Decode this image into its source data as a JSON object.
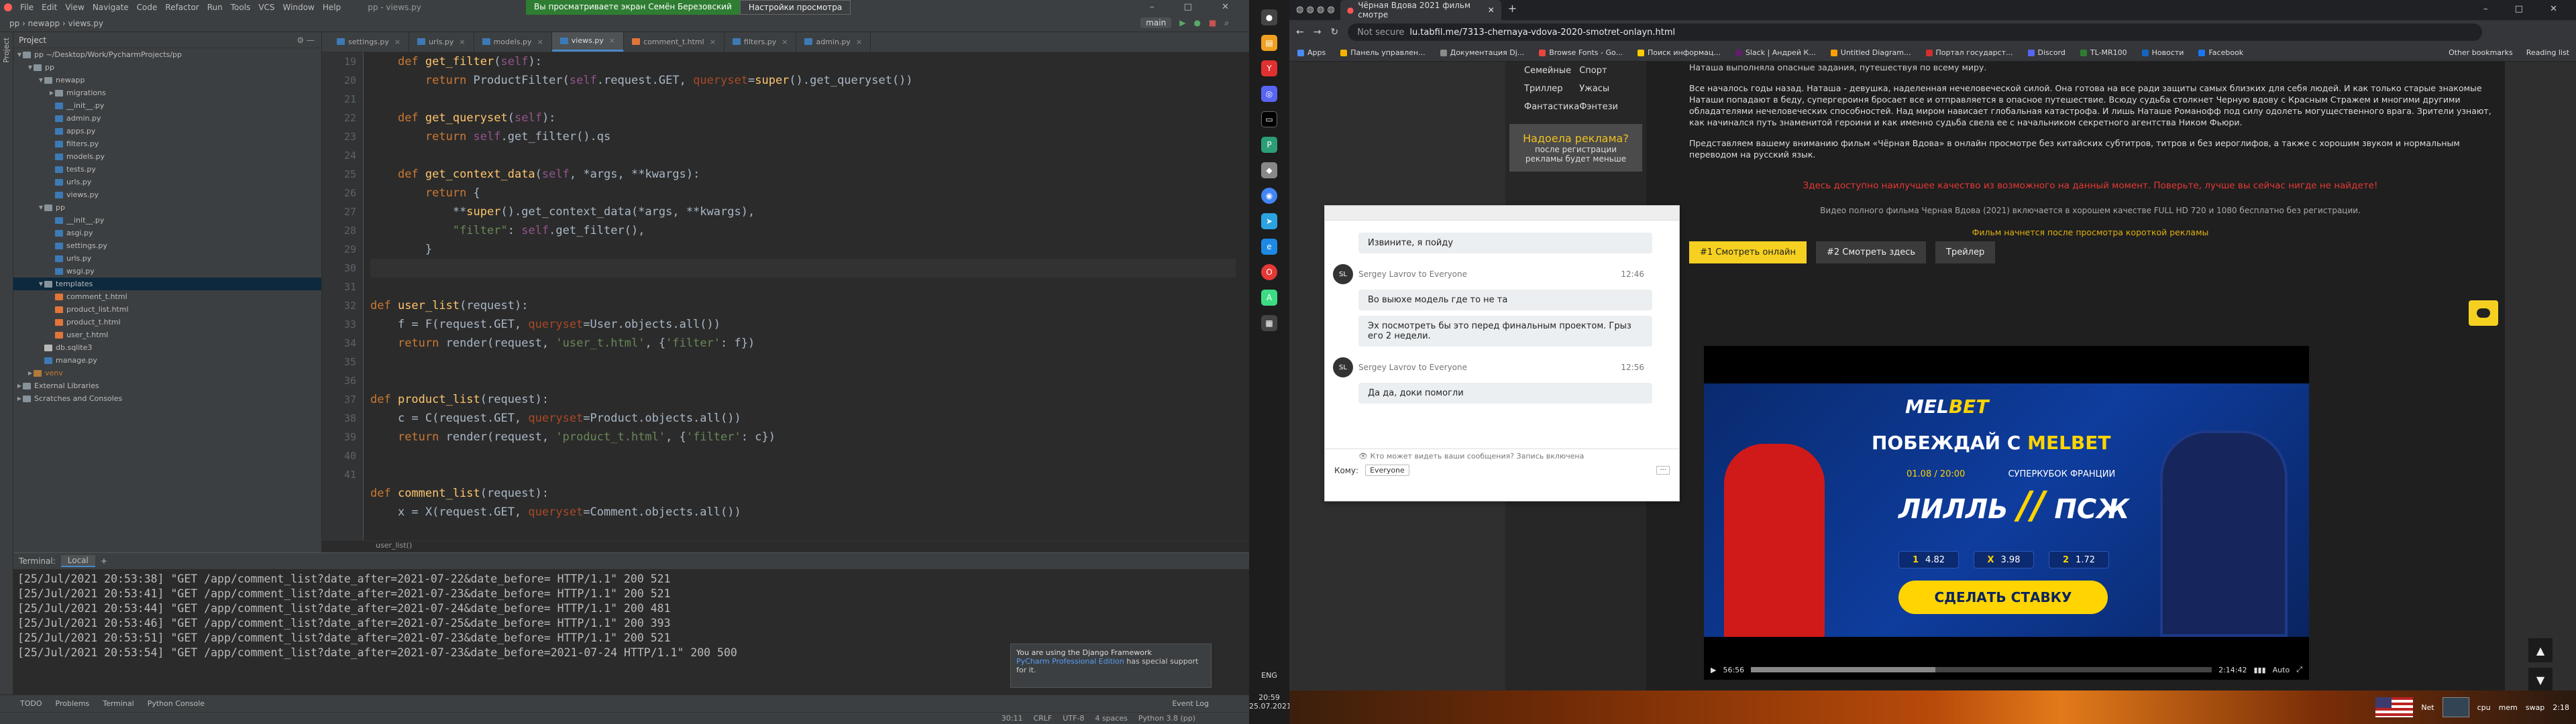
{
  "ide": {
    "menu": [
      "File",
      "Edit",
      "View",
      "Navigate",
      "Code",
      "Refactor",
      "Run",
      "Tools",
      "VCS",
      "Window",
      "Help"
    ],
    "share_banner": "Вы просматриваете экран Семён Березовский",
    "share_settings": "Настройки просмотра",
    "breadcrumb": [
      "pp",
      "newapp",
      "views.py"
    ],
    "run_config": "main",
    "window_title": "pp - views.py",
    "project_title": "Project",
    "project_root": "pp ~/Desktop/Work/PycharmProjects/pp",
    "tree": [
      {
        "indent": 1,
        "type": "fold",
        "label": "pp",
        "open": true
      },
      {
        "indent": 2,
        "type": "fold",
        "label": "newapp",
        "open": true
      },
      {
        "indent": 3,
        "type": "fold",
        "label": "migrations",
        "open": false
      },
      {
        "indent": 3,
        "type": "py",
        "label": "__init__.py"
      },
      {
        "indent": 3,
        "type": "py",
        "label": "admin.py"
      },
      {
        "indent": 3,
        "type": "py",
        "label": "apps.py"
      },
      {
        "indent": 3,
        "type": "py",
        "label": "filters.py"
      },
      {
        "indent": 3,
        "type": "py",
        "label": "models.py"
      },
      {
        "indent": 3,
        "type": "py",
        "label": "tests.py"
      },
      {
        "indent": 3,
        "type": "py",
        "label": "urls.py"
      },
      {
        "indent": 3,
        "type": "py",
        "label": "views.py"
      },
      {
        "indent": 2,
        "type": "fold",
        "label": "pp",
        "open": true
      },
      {
        "indent": 3,
        "type": "py",
        "label": "__init__.py"
      },
      {
        "indent": 3,
        "type": "py",
        "label": "asgi.py"
      },
      {
        "indent": 3,
        "type": "py",
        "label": "settings.py"
      },
      {
        "indent": 3,
        "type": "py",
        "label": "urls.py"
      },
      {
        "indent": 3,
        "type": "py",
        "label": "wsgi.py"
      },
      {
        "indent": 2,
        "type": "fold",
        "label": "templates",
        "open": true,
        "selected": true
      },
      {
        "indent": 3,
        "type": "html",
        "label": "comment_t.html"
      },
      {
        "indent": 3,
        "type": "html",
        "label": "product_list.html"
      },
      {
        "indent": 3,
        "type": "html",
        "label": "product_t.html"
      },
      {
        "indent": 3,
        "type": "html",
        "label": "user_t.html"
      },
      {
        "indent": 2,
        "type": "db",
        "label": "db.sqlite3"
      },
      {
        "indent": 2,
        "type": "py",
        "label": "manage.py"
      },
      {
        "indent": 1,
        "type": "fold",
        "label": "venv",
        "open": false,
        "excluded": true
      },
      {
        "indent": 0,
        "type": "fold",
        "label": "External Libraries",
        "open": false
      },
      {
        "indent": 0,
        "type": "fold",
        "label": "Scratches and Consoles",
        "open": false
      }
    ],
    "tabs": [
      "settings.py",
      "urls.py",
      "models.py",
      "views.py",
      "comment_t.html",
      "filters.py",
      "admin.py"
    ],
    "active_tab": "views.py",
    "line_numbers": [
      "19",
      "20",
      "21",
      "22",
      "23",
      "24",
      "25",
      "26",
      "27",
      "28",
      "29",
      "30",
      "31",
      "32",
      "33",
      "34",
      "35",
      "36",
      "37",
      "38",
      "39",
      "40",
      "41"
    ],
    "highlight_line": 30,
    "code": [
      [
        [
          "    ",
          ""
        ],
        [
          "def ",
          "kw"
        ],
        [
          "get_filter",
          "fn"
        ],
        [
          "(",
          ""
        ],
        [
          "self",
          "sf"
        ],
        [
          "):",
          ""
        ]
      ],
      [
        [
          "        ",
          ""
        ],
        [
          "return ",
          "kw"
        ],
        [
          "ProductFilter(",
          ""
        ],
        [
          "self",
          "sf"
        ],
        [
          ".request.GET, ",
          ""
        ],
        [
          "queryset",
          "prm"
        ],
        [
          "=",
          ""
        ],
        [
          "super",
          "fn"
        ],
        [
          "().get_queryset())",
          ""
        ]
      ],
      [
        [
          "",
          ""
        ]
      ],
      [
        [
          "    ",
          ""
        ],
        [
          "def ",
          "kw"
        ],
        [
          "get_queryset",
          "fn"
        ],
        [
          "(",
          ""
        ],
        [
          "self",
          "sf"
        ],
        [
          "):",
          ""
        ]
      ],
      [
        [
          "        ",
          ""
        ],
        [
          "return ",
          "kw"
        ],
        [
          "self",
          "sf"
        ],
        [
          ".get_filter().qs",
          ""
        ]
      ],
      [
        [
          "",
          ""
        ]
      ],
      [
        [
          "    ",
          ""
        ],
        [
          "def ",
          "kw"
        ],
        [
          "get_context_data",
          "fn"
        ],
        [
          "(",
          ""
        ],
        [
          "self",
          "sf"
        ],
        [
          ", *args, **kwargs):",
          ""
        ]
      ],
      [
        [
          "        ",
          ""
        ],
        [
          "return ",
          "kw"
        ],
        [
          "{",
          ""
        ]
      ],
      [
        [
          "            **",
          ""
        ],
        [
          "super",
          "fn"
        ],
        [
          "().get_context_data(*args, **kwargs),",
          ""
        ]
      ],
      [
        [
          "            ",
          ""
        ],
        [
          "\"filter\"",
          "str"
        ],
        [
          ": ",
          ""
        ],
        [
          "self",
          "sf"
        ],
        [
          ".get_filter(),",
          ""
        ]
      ],
      [
        [
          "        }",
          ""
        ]
      ],
      [
        [
          "",
          ""
        ]
      ],
      [
        [
          "",
          ""
        ]
      ],
      [
        [
          "def ",
          "kw"
        ],
        [
          "user_list",
          "fn"
        ],
        [
          "(request):",
          ""
        ]
      ],
      [
        [
          "    f = F(request.GET, ",
          ""
        ],
        [
          "queryset",
          "prm"
        ],
        [
          "=User.objects.all())",
          ""
        ]
      ],
      [
        [
          "    ",
          ""
        ],
        [
          "return ",
          "kw"
        ],
        [
          "render(request, ",
          ""
        ],
        [
          "'user_t.html'",
          "str"
        ],
        [
          ", {",
          ""
        ],
        [
          "'filter'",
          "str"
        ],
        [
          ": f})",
          ""
        ]
      ],
      [
        [
          "",
          ""
        ]
      ],
      [
        [
          "",
          ""
        ]
      ],
      [
        [
          "def ",
          "kw"
        ],
        [
          "product_list",
          "fn"
        ],
        [
          "(request):",
          ""
        ]
      ],
      [
        [
          "    c = C(request.GET, ",
          ""
        ],
        [
          "queryset",
          "prm"
        ],
        [
          "=Product.objects.all())",
          ""
        ]
      ],
      [
        [
          "    ",
          ""
        ],
        [
          "return ",
          "kw"
        ],
        [
          "render(request, ",
          ""
        ],
        [
          "'product_t.html'",
          "str"
        ],
        [
          ", {",
          ""
        ],
        [
          "'filter'",
          "str"
        ],
        [
          ": c})",
          ""
        ]
      ],
      [
        [
          "",
          ""
        ]
      ],
      [
        [
          "",
          ""
        ]
      ],
      [
        [
          "def ",
          "kw"
        ],
        [
          "comment_list",
          "fn"
        ],
        [
          "(request):",
          ""
        ]
      ],
      [
        [
          "    x = X(request.GET, ",
          ""
        ],
        [
          "queryset",
          "prm"
        ],
        [
          "=Comment.objects.all())",
          ""
        ]
      ]
    ],
    "editor_footer": "user_list()",
    "terminal_title": "Terminal:",
    "terminal_tab": "Local",
    "terminal_lines": [
      "[25/Jul/2021 20:53:38] \"GET /app/comment_list?date_after=2021-07-22&date_before= HTTP/1.1\" 200 521",
      "[25/Jul/2021 20:53:41] \"GET /app/comment_list?date_after=2021-07-23&date_before= HTTP/1.1\" 200 521",
      "[25/Jul/2021 20:53:44] \"GET /app/comment_list?date_after=2021-07-24&date_before= HTTP/1.1\" 200 481",
      "[25/Jul/2021 20:53:46] \"GET /app/comment_list?date_after=2021-07-25&date_before= HTTP/1.1\" 200 393",
      "[25/Jul/2021 20:53:51] \"GET /app/comment_list?date_after=2021-07-23&date_before= HTTP/1.1\" 200 521",
      "[25/Jul/2021 20:53:54] \"GET /app/comment_list?date_after=2021-07-23&date_before=2021-07-24 HTTP/1.1\" 200 500"
    ],
    "notice_title": "You are using the Django Framework",
    "notice_link": "PyCharm Professional Edition",
    "notice_text": "has special support for it.",
    "bottom_tools": [
      "TODO",
      "Problems",
      "Terminal",
      "Python Console"
    ],
    "event_log": "Event Log",
    "status": [
      "30:11",
      "CRLF",
      "UTF-8",
      "4 spaces",
      "Python 3.8 (pp)"
    ]
  },
  "taskbar": {
    "lang": "ENG",
    "time": "20:59",
    "date": "25.07.2021"
  },
  "browser": {
    "tab_title": "Чёрная Вдова 2021 фильм смотре",
    "url_prefix": "Not secure",
    "url": "lu.tabfil.me/7313-chernaya-vdova-2020-smotret-onlayn.html",
    "bookmarks": [
      "Apps",
      "Панель управлен...",
      "Документация Dj...",
      "Browse Fonts - Go...",
      "Поиск информац...",
      "Slack | Андрей К...",
      "Untitled Diagram...",
      "Портал государст...",
      "Discord",
      "TL-MR100",
      "Новости",
      "Facebook"
    ],
    "bookmarks_right": [
      "Other bookmarks",
      "Reading list"
    ],
    "genres": [
      "Семейные",
      "Спорт",
      "Триллер",
      "Ужасы",
      "Фантастика",
      "Фэнтези"
    ],
    "ad_title": "Надоела реклама?",
    "ad_sub": "после регистрации рекламы будет меньше",
    "para0": "Наташа выполняла опасные задания, путешествуя по всему миру.",
    "para1": "Все началось годы назад. Наташа - девушка, наделенная нечеловеческой силой. Она готова на все ради защиты самых близких для себя людей. И как только старые знакомые Наташи попадают в беду, супергероиня бросает все и отправляется в опасное путешествие. Всюду судьба столкнет Черную вдову с Красным Стражем и многими другими обладателями нечеловеческих способностей. Над миром нависает глобальная катастрофа. И лишь Наташе Романофф под силу одолеть могущественного врага. Зрители узнают, как начинался путь знаменитой героини и как именно судьба свела ее с начальником секретного агентства Ником Фьюри.",
    "para2": "Представляем вашему вниманию фильм «Чёрная Вдова» в онлайн просмотре без китайских субтитров, титров и без иероглифов, а также с хорошим звуком и нормальным переводом на русский язык.",
    "red_notice": "Здесь доступно наилучшее качество из возможного на данный момент. Поверьте, лучше вы сейчас нигде не найдете!",
    "grey_notice": "Видео полного фильма Черная Вдова (2021) включается в хорошем качестве FULL HD 720 и 1080 бесплатно без регистрации.",
    "yellow_notice": "Фильм начнется после просмотра короткой рекламы",
    "watch_btn1": "#1 Смотреть онлайн",
    "watch_btn2": "#2 Смотреть здесь",
    "trailer_btn": "Трейлер",
    "ad": {
      "logo_a": "MEL",
      "logo_b": "BET",
      "headline_a": "ПОБЕЖДАЙ С ",
      "headline_b": "MELBET",
      "date": "01.08 / 20:00",
      "tag": "СУПЕРКУБОК ФРАНЦИИ",
      "team1": "ЛИЛЛЬ",
      "team2": "ПСЖ",
      "odds": [
        [
          "1",
          "4.82"
        ],
        [
          "X",
          "3.98"
        ],
        [
          "2",
          "1.72"
        ]
      ],
      "cta": "СДЕЛАТЬ СТАВКУ"
    },
    "player_time": "56:56",
    "player_duration": "2:14:42",
    "player_progress": 0.4,
    "player_quality": "Auto",
    "scroll_up": "▲",
    "scroll_down": "▼"
  },
  "chat": {
    "messages": [
      {
        "type": "bubble",
        "text": "Извините, я пойду"
      },
      {
        "type": "sender",
        "avatar": "SL",
        "name": "Sergey Lavrov to Everyone",
        "time": "12:46"
      },
      {
        "type": "bubble",
        "text": "Во выюхе модель где то не та"
      },
      {
        "type": "bubble",
        "text": "Эх посмотреть бы это перед финальным проектом. Грыз его 2 недели."
      },
      {
        "type": "sender",
        "avatar": "SL",
        "name": "Sergey Lavrov to Everyone",
        "time": "12:56"
      },
      {
        "type": "bubble",
        "text": "Да да, доки помогли"
      }
    ],
    "who_can_see": "Кто может видеть ваши сообщения? Запись включена",
    "to_label": "Кому:",
    "to_value": "Everyone"
  },
  "osbar": {
    "tray": [
      "Net",
      "cpu",
      "mem",
      "swap",
      "2:18"
    ]
  }
}
